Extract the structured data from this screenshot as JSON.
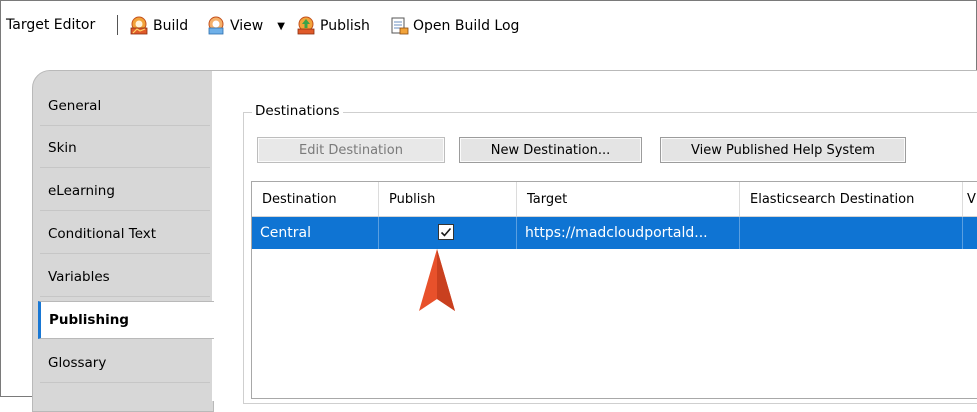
{
  "toolbar": {
    "title": "Target Editor",
    "build_label": "Build",
    "view_label": "View",
    "publish_label": "Publish",
    "open_build_log_label": "Open Build Log"
  },
  "tabs": [
    {
      "label": "General"
    },
    {
      "label": "Skin"
    },
    {
      "label": "eLearning"
    },
    {
      "label": "Conditional Text"
    },
    {
      "label": "Variables"
    },
    {
      "label": "Publishing",
      "active": true
    },
    {
      "label": "Glossary"
    }
  ],
  "destinations": {
    "group_label": "Destinations",
    "buttons": {
      "edit": "Edit Destination",
      "new": "New Destination...",
      "view_published": "View Published Help System"
    },
    "columns": [
      "Destination",
      "Publish",
      "Target",
      "Elasticsearch Destination",
      "V"
    ],
    "rows": [
      {
        "destination": "Central",
        "publish": true,
        "target": "https://madcloudportald...",
        "elasticsearch": ""
      }
    ]
  },
  "colors": {
    "selection": "#0f74d3",
    "active_tab_accent": "#1877d4",
    "pointer": "#e8512b"
  }
}
